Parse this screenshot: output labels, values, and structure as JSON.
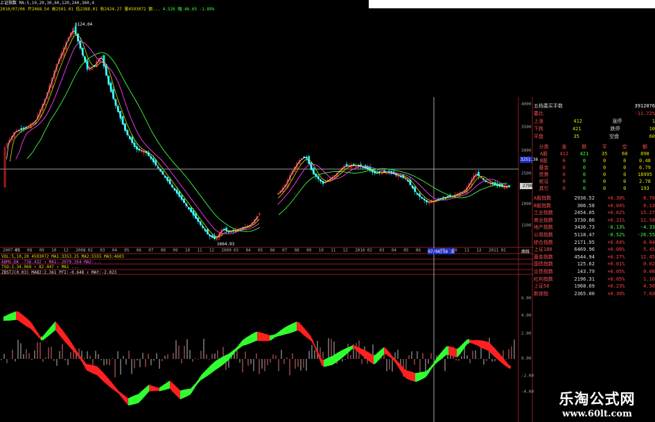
{
  "header": {
    "title": "上证指数",
    "ma_line": "MA:5,10,20,30,60,120,240,360,4",
    "price_line": "2010/07/06 开2468.54 高2501.01 低2388.01 收2424.27 量4593072 额...",
    "ind_line": "4.526 幅-46.65 -1.89%"
  },
  "main_chart": {
    "high_label": "6124.04",
    "low_label": "1664.93",
    "x_labels": [
      "2007-05",
      "07",
      "08",
      "09",
      "10",
      "12",
      "2008",
      "02",
      "03",
      "04",
      "05",
      "06",
      "07",
      "08",
      "09",
      "10",
      "11",
      "12",
      "2009",
      "03",
      "04",
      "05",
      "06",
      "07",
      "08",
      "09",
      "10",
      "11",
      "12",
      "2010",
      "02",
      "03",
      "04",
      "05",
      "06",
      "07/06/16 五",
      "09",
      "10",
      "11",
      "12",
      "2011",
      "02"
    ],
    "cursor_date": "07/06/16 五",
    "right_end_label": "周线",
    "y_labels": [
      "4000",
      "3500",
      "3000",
      "2500",
      "2000",
      "1500"
    ],
    "price_tag": "3251.36",
    "last_tag": "2799"
  },
  "indicator_rows": [
    "VOL:5,10,20 4593072 MA1:3353.25 MA2:5555 MA3:4603",
    "ADMS:DK -736.432 ↑ MA1:-2079.354 MA2:...",
    "TSO:2.34.969 ↑ 82.447 ↑ MA1 ...",
    "ZBSTJ(0.03) MAB2:2.361 PFI:-0.648 ↑ MAY:-2.023"
  ],
  "lower_chart": {
    "y_labels": [
      "6.00",
      "4.00",
      "2.00",
      "0.00",
      "-2.00",
      "-4.00"
    ]
  },
  "side_panel": {
    "title": "五档委买手数",
    "title_value": "3912076",
    "ratio_label": "委比",
    "ratio_value": "-11.72%",
    "breadth": [
      {
        "label": "上涨",
        "v1": "412",
        "label2": "涨停",
        "v2": "1"
      },
      {
        "label": "下跌",
        "v1": "421",
        "label2": "跌停",
        "v2": "10"
      },
      {
        "label": "平盘",
        "v1": "35",
        "label2": "空盘",
        "v2": "60"
      }
    ],
    "table_headers": [
      "分类",
      "涨",
      "跌",
      "平",
      "空",
      "额"
    ],
    "table_rows": [
      [
        "A股",
        "412",
        "421",
        "35",
        "60",
        "898"
      ],
      [
        "B股",
        "0",
        "0",
        "0",
        "0",
        "0.48"
      ],
      [
        "基金",
        "0",
        "0",
        "0",
        "0",
        "6.79"
      ],
      [
        "债券",
        "0",
        "0",
        "0",
        "0",
        "18995"
      ],
      [
        "权证",
        "0",
        "0",
        "0",
        "0",
        "2.78"
      ],
      [
        "其它",
        "0",
        "0",
        "0",
        "0",
        "193"
      ]
    ],
    "indices": [
      {
        "name": "A股指数",
        "value": "2930.52",
        "chg": "+0.30%",
        "pt": "8.70",
        "up": true
      },
      {
        "name": "B股指数",
        "value": "306.58",
        "chg": "+0.04%",
        "pt": "0.13",
        "up": true
      },
      {
        "name": "工业指数",
        "value": "2454.05",
        "chg": "+0.62%",
        "pt": "15.27",
        "up": true
      },
      {
        "name": "商业指数",
        "value": "3730.86",
        "chg": "+0.31%",
        "pt": "11.58",
        "up": true
      },
      {
        "name": "地产指数",
        "value": "3436.73",
        "chg": "-0.13%",
        "pt": "-4.33",
        "up": false
      },
      {
        "name": "公用指数",
        "value": "5118.47",
        "chg": "-0.52%",
        "pt": "-26.55",
        "up": false
      },
      {
        "name": "综合指数",
        "value": "2171.95",
        "chg": "+0.64%",
        "pt": "0.84",
        "up": true
      },
      {
        "name": "上证180",
        "value": "6469.96",
        "chg": "+0.08%",
        "pt": "5.45",
        "up": true
      },
      {
        "name": "基金指数",
        "value": "4544.94",
        "chg": "+0.27%",
        "pt": "12.45",
        "up": true
      },
      {
        "name": "国债指数",
        "value": "125.62",
        "chg": "+0.01%",
        "pt": "0.02",
        "up": true
      },
      {
        "name": "企债指数",
        "value": "143.79",
        "chg": "+0.05%",
        "pt": "0.08",
        "up": true
      },
      {
        "name": "红利指数",
        "value": "2196.31",
        "chg": "+0.05%",
        "pt": "1.16",
        "up": true
      },
      {
        "name": "上证50",
        "value": "1968.69",
        "chg": "+0.23%",
        "pt": "4.50",
        "up": true
      },
      {
        "name": "新综指",
        "value": "2365.00",
        "chg": "+0.30%",
        "pt": "7.03",
        "up": true
      }
    ]
  },
  "watermark": {
    "line1": "乐淘公式网",
    "line2": "www.60lt.com"
  },
  "colors": {
    "up": "#ff3030",
    "down": "#00ffff",
    "ma1": "#ffffff",
    "ma2": "#e0e000",
    "ma3": "#ff40ff",
    "ma4": "#40ff40",
    "ribbon_up": "#ff2020",
    "ribbon_down": "#30ff30"
  }
}
